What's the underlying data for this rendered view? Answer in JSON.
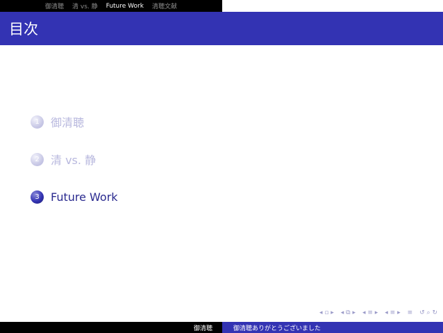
{
  "headline": {
    "items": [
      {
        "label": "御清聴"
      },
      {
        "label": "清 vs. 静"
      },
      {
        "label": "Future Work"
      },
      {
        "label": "清聴文献"
      }
    ],
    "active_index": 2
  },
  "frame_title": "目次",
  "toc": [
    {
      "number": "1",
      "label": "御清聴"
    },
    {
      "number": "2",
      "label": "清 vs. 静"
    },
    {
      "number": "3",
      "label": "Future Work"
    }
  ],
  "nav_icons": [
    "slide-nav-icon",
    "frame-nav-icon",
    "subsection-nav-icon",
    "section-nav-icon",
    "toc-nav-icon",
    "search-nav-icon"
  ],
  "footer": {
    "author": "御清聴",
    "title": "御清聴ありがとうございました"
  },
  "colors": {
    "structure": "#3333b3",
    "black": "#000000",
    "dim": "#b8b8de"
  }
}
